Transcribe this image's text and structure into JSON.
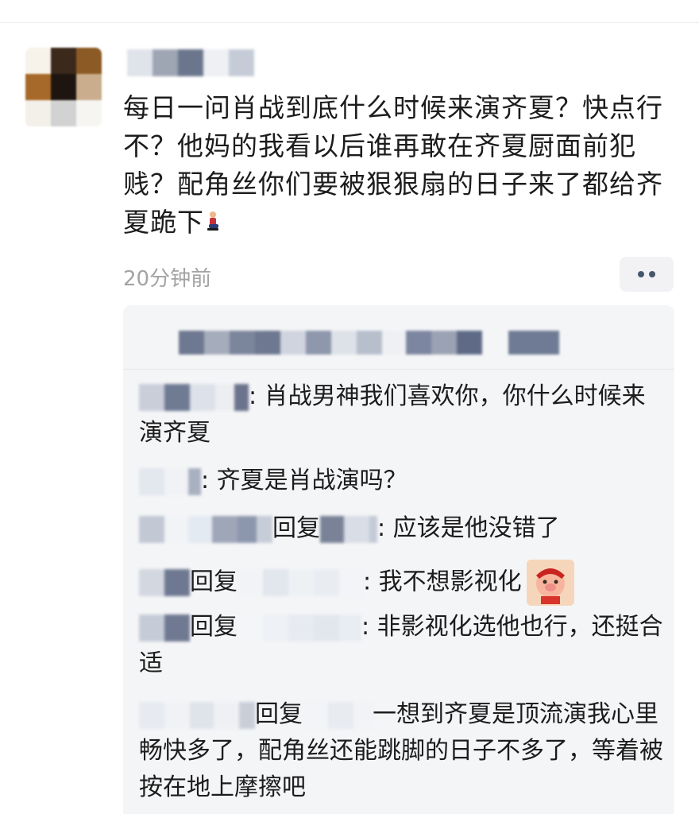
{
  "post": {
    "text": "每日一问肖战到底什么时候来演齐夏？快点行不？他妈的我看以后谁再敢在齐夏厨面前犯贱？配角丝你们要被狠狠扇的日子来了都给齐夏跪下",
    "emoji_icon": "person-kneeling-icon",
    "time": "20分钟前"
  },
  "replies": [
    {
      "sep": ": ",
      "text": "肖战男神我们喜欢你，你什么时候来演齐夏"
    },
    {
      "sep": ": ",
      "text": "齐夏是肖战演吗？"
    },
    {
      "reply_word": "回复",
      "sep": ": ",
      "text": "应该是他没错了"
    },
    {
      "reply_word": "回复",
      "sep": ": ",
      "text": "我不想影视化",
      "sticker_icon": "pig-sticker-icon"
    },
    {
      "reply_word": "回复",
      "sep": ": ",
      "text": "非影视化选他也行，还挺合适"
    },
    {
      "reply_word": "回复",
      "sep": "",
      "text": "一想到齐夏是顶流演我心里畅快多了，配角丝还能跳脚的日子不多了，等着被按在地上摩擦吧"
    }
  ],
  "colors": {
    "background": "#ffffff",
    "reply_box": "#f4f5f7",
    "time": "#a3a3a3",
    "more_dots": "#47566b"
  }
}
